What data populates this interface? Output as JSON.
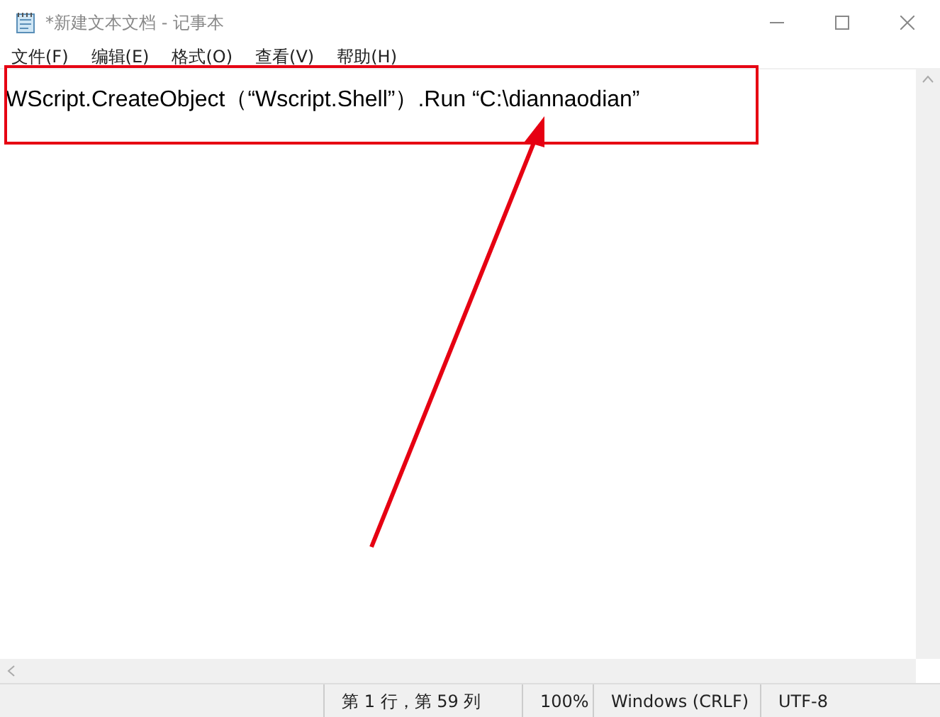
{
  "window": {
    "title": "*新建文本文档 - 记事本"
  },
  "menu": [
    "文件(F)",
    "编辑(E)",
    "格式(O)",
    "查看(V)",
    "帮助(H)"
  ],
  "editor": {
    "text": "WScript.CreateObject（“Wscript.Shell”）.Run “C:\\diannaodian”"
  },
  "status_bar": [
    "第 1 行，第 59 列",
    "100%",
    "Windows (CRLF)",
    "UTF-8"
  ]
}
